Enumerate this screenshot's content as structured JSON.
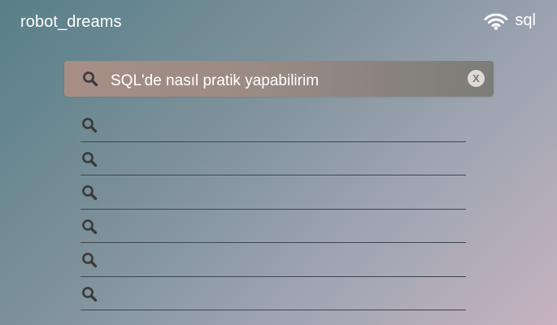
{
  "header": {
    "brand": "robot_dreams",
    "network_icon": "wifi-icon",
    "network_label": "sql"
  },
  "search": {
    "icon": "search-icon",
    "query": "SQL'de nasıl pratik yapabilirim",
    "clear_label": "X"
  },
  "suggestions": [
    {
      "icon": "search-icon",
      "text": ""
    },
    {
      "icon": "search-icon",
      "text": ""
    },
    {
      "icon": "search-icon",
      "text": ""
    },
    {
      "icon": "search-icon",
      "text": ""
    },
    {
      "icon": "search-icon",
      "text": ""
    },
    {
      "icon": "search-icon",
      "text": ""
    }
  ],
  "colors": {
    "text": "#ffffff",
    "divider": "#3f4752",
    "icon_dark": "#3a3a3a",
    "search_bar_start": "#a88e86",
    "search_bar_end": "#7c7d77"
  }
}
